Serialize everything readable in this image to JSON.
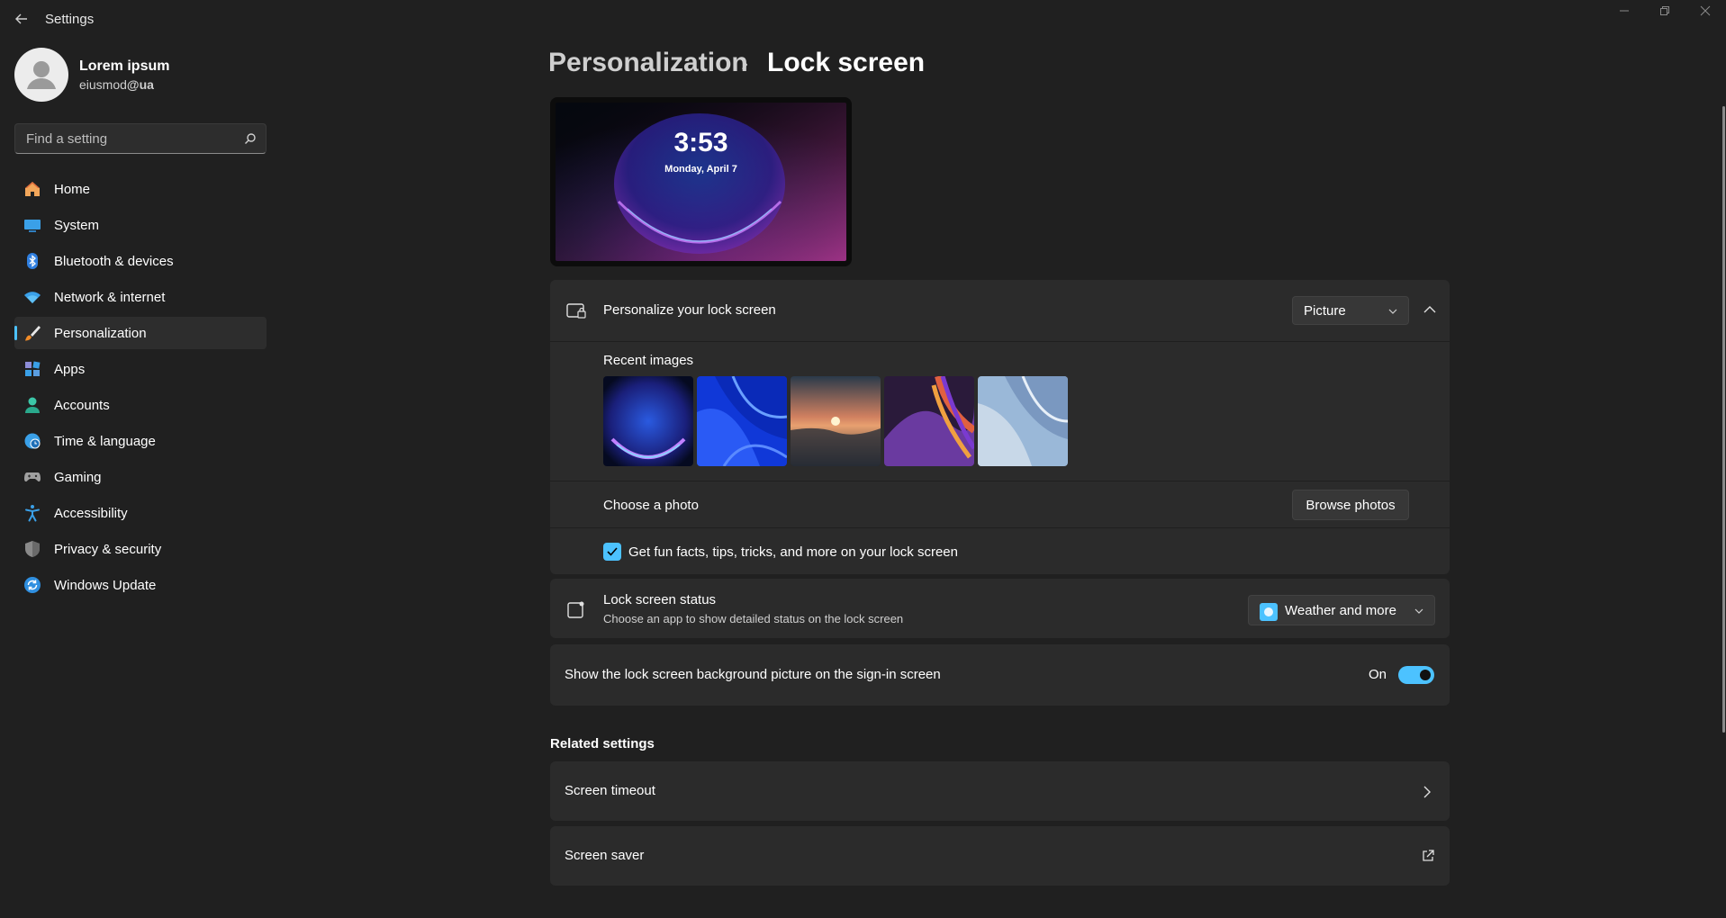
{
  "window": {
    "title": "Settings",
    "minimize_icon": "minimize-icon",
    "maximize_icon": "restore-icon",
    "close_icon": "close-icon"
  },
  "profile": {
    "name": "Lorem ipsum",
    "email_prefix": "eiusmod",
    "email_suffix": "@ua"
  },
  "search": {
    "placeholder": "Find a setting"
  },
  "sidebar": {
    "items": [
      {
        "label": "Home",
        "icon": "home-icon"
      },
      {
        "label": "System",
        "icon": "monitor-icon"
      },
      {
        "label": "Bluetooth & devices",
        "icon": "bluetooth-icon"
      },
      {
        "label": "Network & internet",
        "icon": "wifi-icon"
      },
      {
        "label": "Personalization",
        "icon": "brush-icon",
        "active": true
      },
      {
        "label": "Apps",
        "icon": "apps-icon"
      },
      {
        "label": "Accounts",
        "icon": "person-icon"
      },
      {
        "label": "Time & language",
        "icon": "globe-clock-icon"
      },
      {
        "label": "Gaming",
        "icon": "gamepad-icon"
      },
      {
        "label": "Accessibility",
        "icon": "accessibility-icon"
      },
      {
        "label": "Privacy & security",
        "icon": "shield-icon"
      },
      {
        "label": "Windows Update",
        "icon": "update-icon"
      }
    ]
  },
  "breadcrumb": {
    "parent": "Personalization",
    "separator": "›",
    "current": "Lock screen"
  },
  "preview": {
    "time": "3:53",
    "date": "Monday, April 7"
  },
  "personalize": {
    "label": "Personalize your lock screen",
    "dropdown_value": "Picture",
    "recent_images_label": "Recent images",
    "recent_images": [
      "bloom-dark",
      "blue-ribbons",
      "sunset-lake",
      "purple-swirl",
      "light-ribbons"
    ],
    "choose_photo_label": "Choose a photo",
    "browse_button": "Browse photos",
    "fun_facts_label": "Get fun facts, tips, tricks, and more on your lock screen",
    "fun_facts_checked": true
  },
  "status": {
    "label": "Lock screen status",
    "description": "Choose an app to show detailed status on the lock screen",
    "dropdown_value": "Weather and more"
  },
  "signin": {
    "label": "Show the lock screen background picture on the sign-in screen",
    "state_label": "On",
    "enabled": true
  },
  "related": {
    "title": "Related settings",
    "items": [
      {
        "label": "Screen timeout",
        "icon": "chevron-right-icon"
      },
      {
        "label": "Screen saver",
        "icon": "external-link-icon"
      }
    ]
  },
  "colors": {
    "accent": "#4cc2ff",
    "background": "#202020",
    "card": "#2b2b2b"
  }
}
